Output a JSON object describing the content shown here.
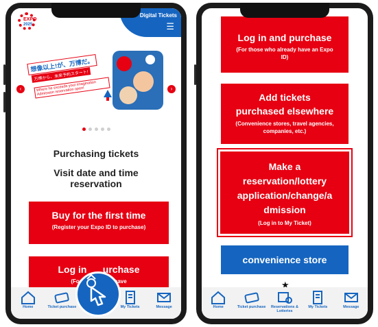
{
  "left_phone": {
    "header": {
      "logo_line1": "EXPO",
      "logo_line2": "2025",
      "digital_label": "Digital Tickets",
      "menu_glyph": "☰"
    },
    "banner": {
      "headline_jp": "想像以上!が、万博だ。",
      "subline_jp": "万博から、未来予約スタート!",
      "english_text": "Where he exceeds your imagination Admission reservation open!",
      "arrow_left": "‹",
      "arrow_right": "›"
    },
    "carousel": {
      "count": 5,
      "active": 0
    },
    "headings": {
      "purchasing": "Purchasing tickets",
      "visit": "Visit date and time reservation"
    },
    "buy_button": {
      "main": "Buy for the first time",
      "sub": "(Register your Expo ID to purchase)"
    },
    "login_button": {
      "main": "Log in      urchase",
      "sub": "(For th             ly have"
    },
    "fab_icon": "tap-gesture-icon"
  },
  "right_phone": {
    "login_button": {
      "main": "Log in and purchase",
      "sub": "(For those who already have an Expo ID)"
    },
    "add_button": {
      "main": "Add tickets purchased elsewhere",
      "sub": "(Convenience stores, travel agencies, companies, etc.)"
    },
    "reserve_button": {
      "main": "Make a reservation/lottery application/change/a dmission",
      "sub": "(Log in to My Ticket)"
    },
    "store_button": {
      "main": "convenience store"
    },
    "star": "★",
    "partial_text": "                   "
  },
  "nav": [
    {
      "label": "Home",
      "icon": "home-icon"
    },
    {
      "label": "Ticket purchase",
      "icon": "ticket-icon"
    },
    {
      "label": "Reservations & Lotteries",
      "icon": "calendar-bus-icon"
    },
    {
      "label": "My Tickets",
      "icon": "my-tickets-icon"
    },
    {
      "label": "Message",
      "icon": "mail-icon"
    }
  ],
  "colors": {
    "brand_red": "#e60012",
    "brand_blue": "#1565c0"
  }
}
